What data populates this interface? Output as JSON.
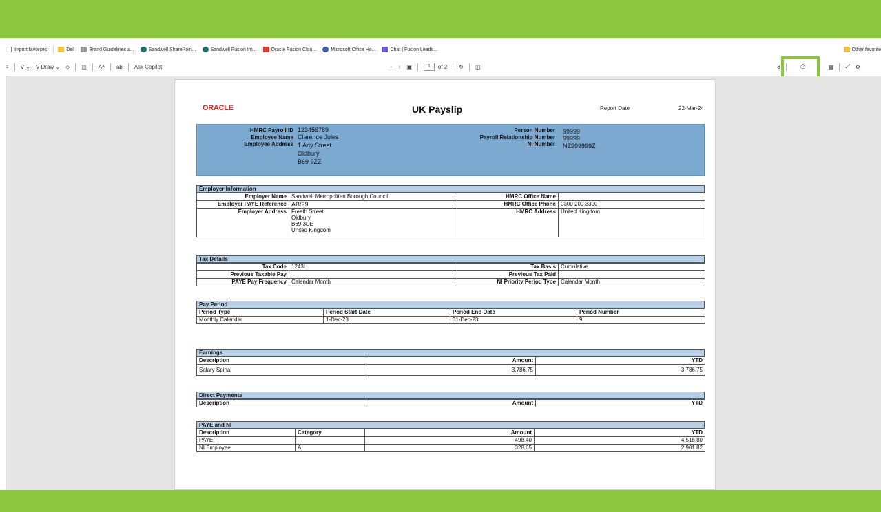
{
  "favorites": {
    "items": [
      {
        "label": "Import favorites",
        "color": "#888888"
      },
      {
        "label": "Dell",
        "color": "#f0c040"
      },
      {
        "label": "Brand Guidelines a...",
        "color": "#999999"
      },
      {
        "label": "Sandwell SharePoin...",
        "color": "#1f6f6b"
      },
      {
        "label": "Sandwell Fusion Im...",
        "color": "#1f6f6b"
      },
      {
        "label": "Oracle Fusion Clou...",
        "color": "#d83a2b"
      },
      {
        "label": "Microsoft Office Ho...",
        "color": "#3b5fa8"
      },
      {
        "label": "Chat | Fusion Leads...",
        "color": "#6a5acd"
      }
    ],
    "other": "Other favorite"
  },
  "toolbar": {
    "draw_label": "Draw",
    "font_label": "Aᴬ",
    "read_aloud": "a̶b",
    "ask_copilot": "Ask Copilot",
    "zoom_out": "−",
    "zoom_in": "+",
    "page_current": "1",
    "page_total": "of 2"
  },
  "payslip": {
    "logo": "ORACLE",
    "title": "UK Payslip",
    "report_date_label": "Report Date",
    "report_date": "22-Mar-24",
    "header": {
      "payroll_id_label": "HMRC Payroll ID",
      "payroll_id": "123456789",
      "employee_name_label": "Employee Name",
      "employee_name": "Clarence Jules",
      "employee_address_label": "Employee Address",
      "employee_address": [
        "1 Any Street",
        "Oldbury",
        "B69 9ZZ"
      ],
      "person_number_label": "Person Number",
      "person_number": "99999",
      "payroll_rel_label": "Payroll Relationship Number",
      "payroll_rel": "99999",
      "ni_number_label": "NI Number",
      "ni_number": "NZ999999Z"
    },
    "employer": {
      "section": "Employer Information",
      "name_label": "Employer Name",
      "name": "Sandwell Metropolitan Borough Council",
      "paye_label": "Employer PAYE Reference",
      "paye": "AB/99",
      "address_label": "Employer Address",
      "address": "Freeth Street\nOldbury\nB69 3DE\nUnited Kingdom",
      "office_name_label": "HMRC Office Name",
      "office_name": "",
      "office_phone_label": "HMRC Office Phone",
      "office_phone": "0300 200 3300",
      "hmrc_address_label": "HMRC Address",
      "hmrc_address": "United Kingdom"
    },
    "tax": {
      "section": "Tax Details",
      "tax_code_label": "Tax Code",
      "tax_code": "1243L",
      "prev_taxable_label": "Previous Taxable Pay",
      "prev_taxable": "",
      "paye_freq_label": "PAYE Pay Frequency",
      "paye_freq": "Calendar Month",
      "tax_basis_label": "Tax Basis",
      "tax_basis": "Cumulative",
      "prev_tax_paid_label": "Previous Tax Paid",
      "prev_tax_paid": "",
      "ni_priority_label": "NI Priority Period Type",
      "ni_priority": "Calendar Month"
    },
    "pay_period": {
      "section": "Pay Period",
      "headers": [
        "Period Type",
        "Period Start Date",
        "Period End Date",
        "Period Number"
      ],
      "row": [
        "Monthly Calendar",
        "1-Dec-23",
        "31-Dec-23",
        "9"
      ]
    },
    "earnings": {
      "section": "Earnings",
      "headers": [
        "Description",
        "Amount",
        "YTD"
      ],
      "rows": [
        [
          "Salary Spinal",
          "3,786.75",
          "3,786.75"
        ]
      ]
    },
    "direct_payments": {
      "section": "Direct Payments",
      "headers": [
        "Description",
        "Amount",
        "YTD"
      ]
    },
    "paye_ni": {
      "section": "PAYE and NI",
      "headers": [
        "Description",
        "Category",
        "Amount",
        "YTD"
      ],
      "rows": [
        [
          "PAYE",
          "",
          "498.40",
          "4,518.80"
        ],
        [
          "NI Employee",
          "A",
          "328.65",
          "2,901.82"
        ]
      ]
    }
  }
}
